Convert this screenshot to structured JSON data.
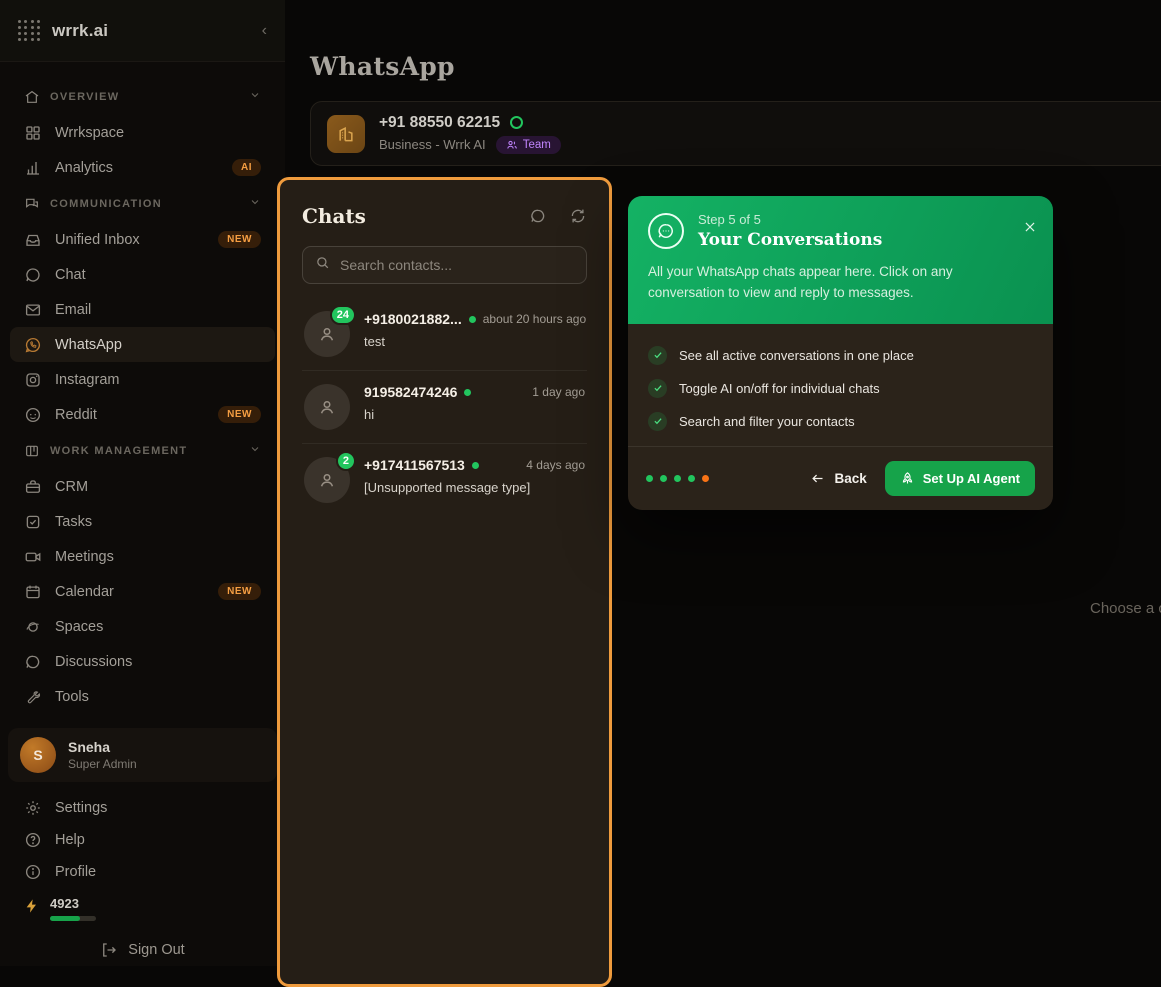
{
  "brand": {
    "name": "wrrk.ai"
  },
  "colors": {
    "highlight_border": "#ef9b3d",
    "tour_green": "#10a55a",
    "cta_green": "#16a34a",
    "unread_green": "#22c55e",
    "badge_orange": "#f59e42",
    "team_purple": "#c084fc"
  },
  "sidebar": {
    "sections": {
      "overview": {
        "label": "OVERVIEW"
      },
      "communication": {
        "label": "COMMUNICATION"
      },
      "work": {
        "label": "WORK MANAGEMENT"
      }
    },
    "items": {
      "wrrkspace": {
        "label": "Wrrkspace"
      },
      "analytics": {
        "label": "Analytics",
        "badge": "AI"
      },
      "unified_inbox": {
        "label": "Unified Inbox",
        "badge": "NEW"
      },
      "chat": {
        "label": "Chat"
      },
      "email": {
        "label": "Email"
      },
      "whatsapp": {
        "label": "WhatsApp"
      },
      "instagram": {
        "label": "Instagram"
      },
      "reddit": {
        "label": "Reddit",
        "badge": "NEW"
      },
      "crm": {
        "label": "CRM"
      },
      "tasks": {
        "label": "Tasks"
      },
      "meetings": {
        "label": "Meetings"
      },
      "calendar": {
        "label": "Calendar",
        "badge": "NEW"
      },
      "spaces": {
        "label": "Spaces"
      },
      "discussions": {
        "label": "Discussions"
      },
      "tools": {
        "label": "Tools"
      }
    },
    "user": {
      "initial": "S",
      "name": "Sneha",
      "role": "Super Admin"
    },
    "bottom": {
      "settings": "Settings",
      "help": "Help",
      "profile": "Profile",
      "credits": "4923",
      "signout": "Sign Out"
    }
  },
  "main": {
    "page_title": "WhatsApp",
    "connection": {
      "phone": "+91 88550 62215",
      "subtitle": "Business - Wrrk AI",
      "team_badge": "Team"
    },
    "empty_hint": "Choose a c"
  },
  "chats": {
    "title": "Chats",
    "search_placeholder": "Search contacts...",
    "rows": {
      "0": {
        "name": "+9180021882...",
        "unread": "24",
        "time": "about 20 hours ago",
        "preview": "test"
      },
      "1": {
        "name": "919582474246",
        "time": "1 day ago",
        "preview": "hi"
      },
      "2": {
        "name": "+917411567513",
        "unread": "2",
        "time": "4 days ago",
        "preview": "[Unsupported message type]"
      }
    }
  },
  "tour": {
    "step_label": "Step 5 of 5",
    "title": "Your Conversations",
    "description": "All your WhatsApp chats appear here. Click on any conversation to view and reply to messages.",
    "checklist": {
      "0": "See all active conversations in one place",
      "1": "Toggle AI on/off for individual chats",
      "2": "Search and filter your contacts"
    },
    "back_label": "Back",
    "cta_label": "Set Up AI Agent"
  }
}
